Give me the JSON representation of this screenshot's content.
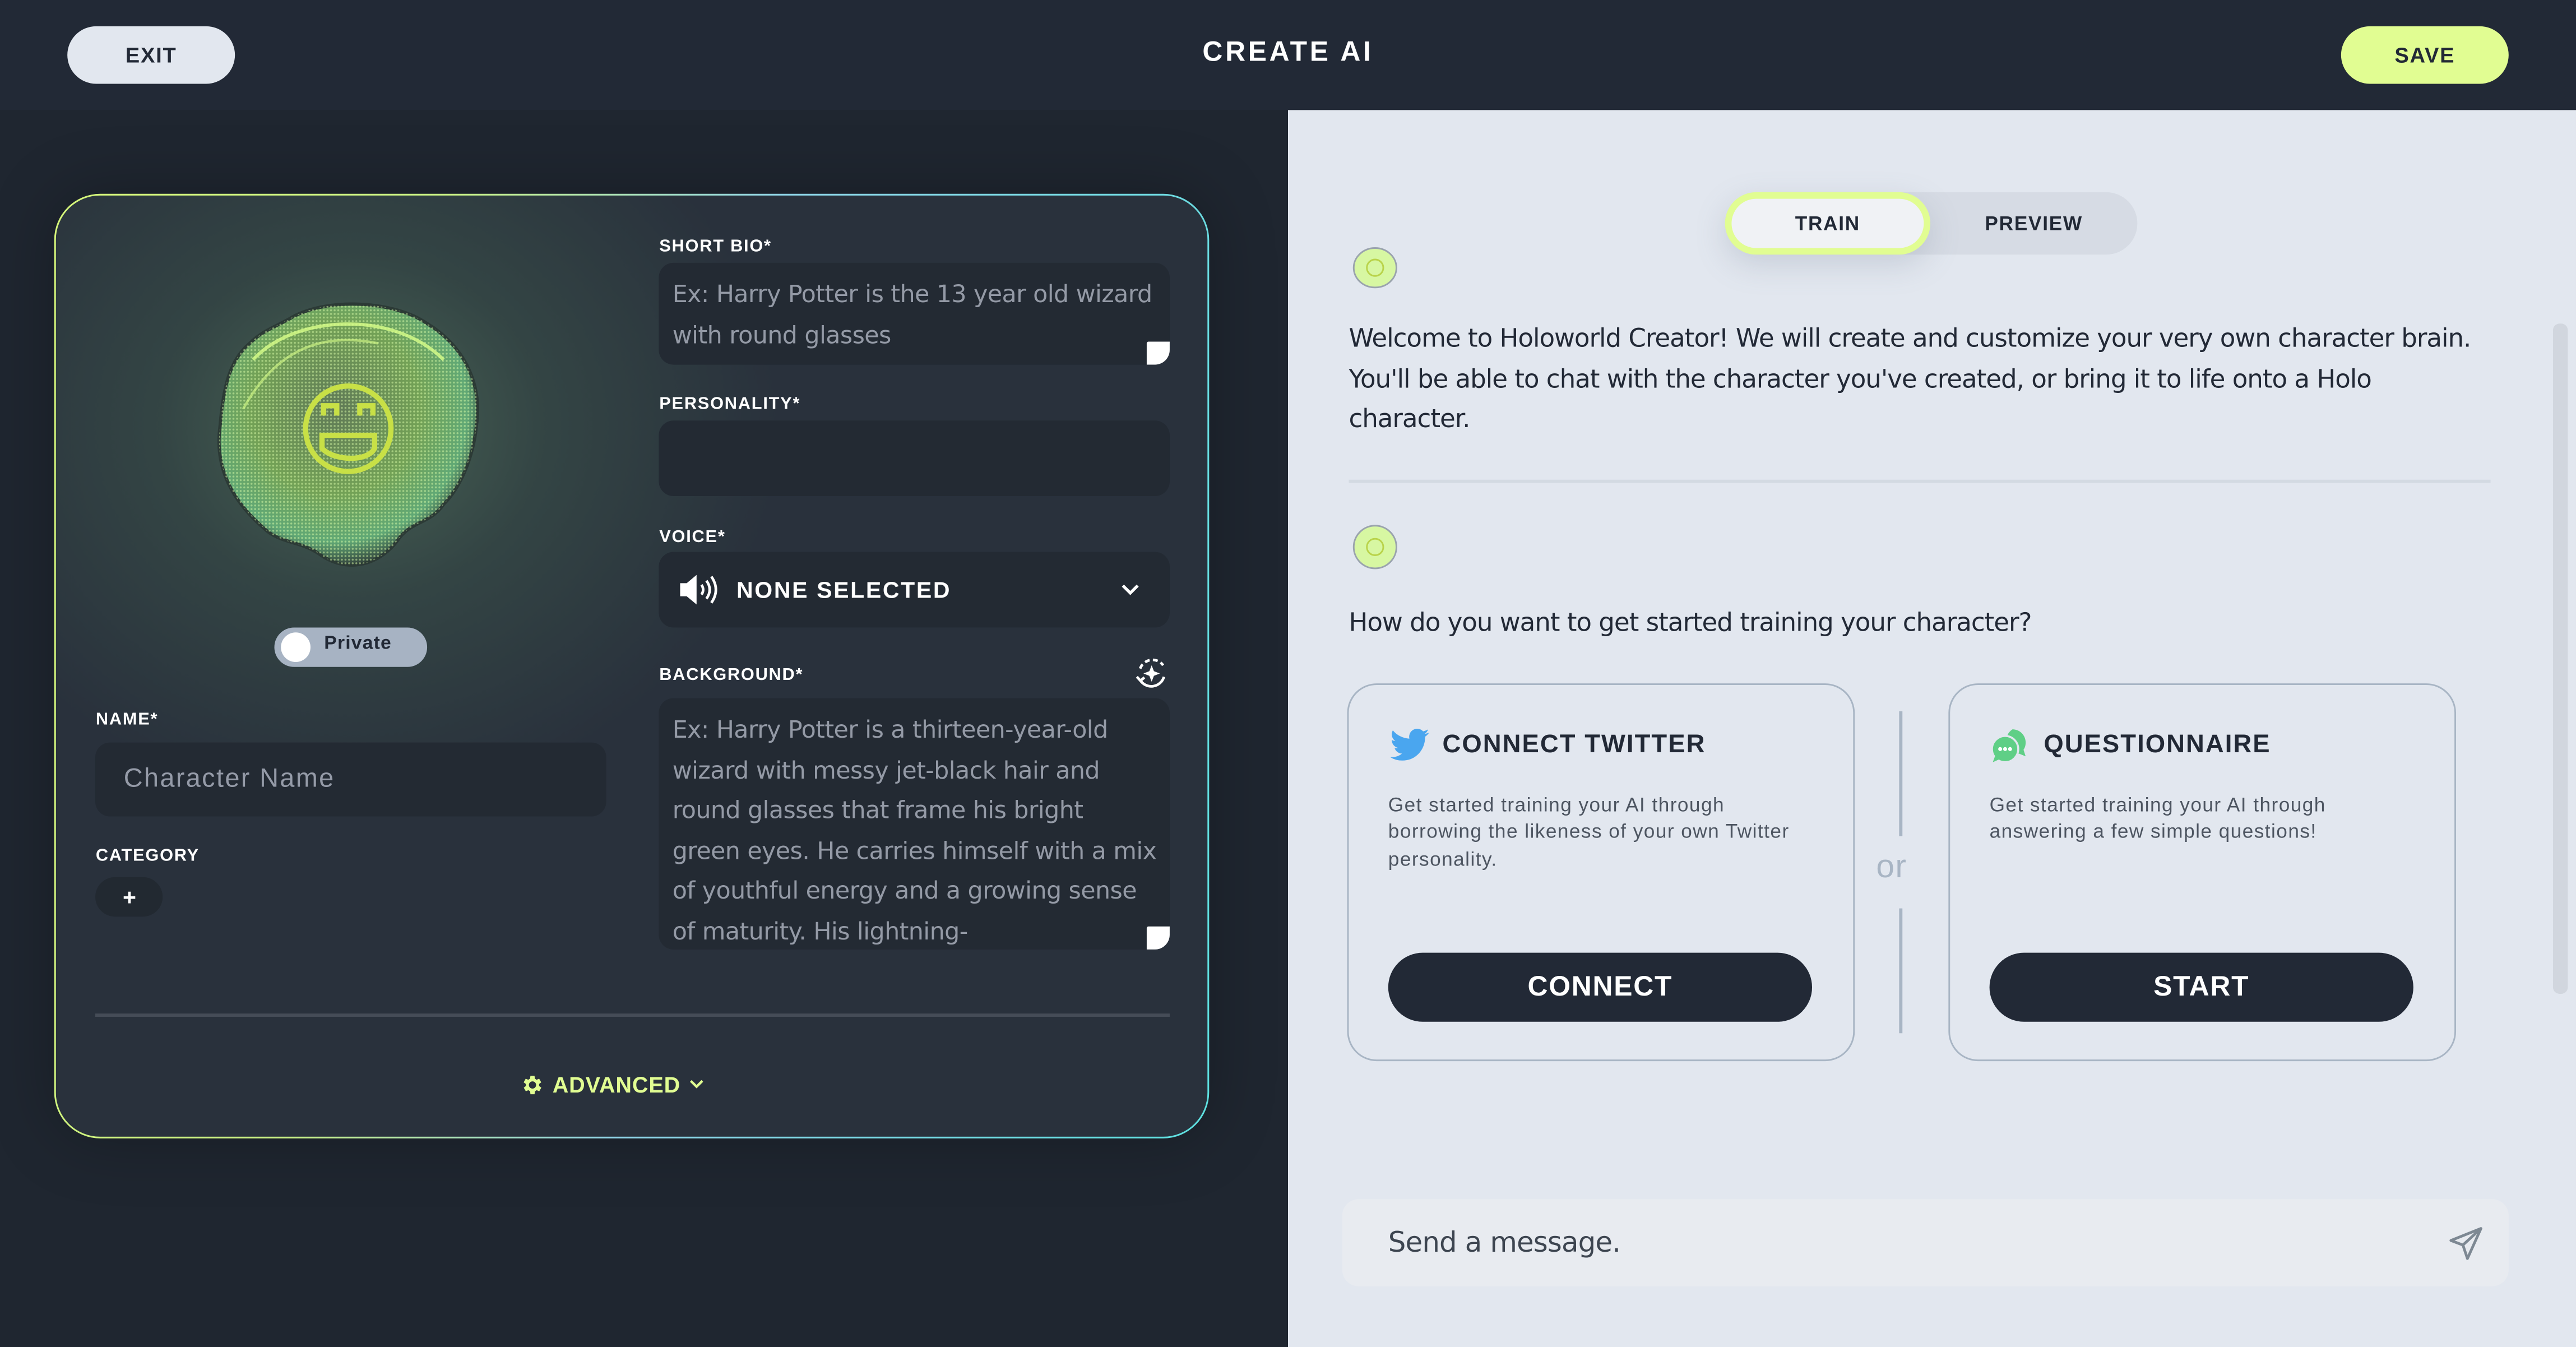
{
  "header": {
    "title": "CREATE AI",
    "exit_label": "EXIT",
    "save_label": "SAVE"
  },
  "colors": {
    "accent": "#e1fd92",
    "header_bg": "#222936",
    "left_bg": "#1f2630",
    "right_bg": "#e2e7ef",
    "twitter_blue": "#4aa6ef",
    "questionnaire_green": "#5fcf86"
  },
  "character_form": {
    "privacy_toggle": {
      "label": "Private",
      "on": false
    },
    "name": {
      "label": "NAME*",
      "value": "",
      "placeholder": "Character Name"
    },
    "category": {
      "label": "CATEGORY",
      "add_label": "+"
    },
    "short_bio": {
      "label": "SHORT BIO*",
      "value": "",
      "placeholder": "Ex: Harry Potter is the 13 year old wizard with round glasses"
    },
    "personality": {
      "label": "PERSONALITY*",
      "value": ""
    },
    "voice": {
      "label": "VOICE*",
      "selected": "NONE SELECTED",
      "icon": "speaker-icon"
    },
    "background": {
      "label": "BACKGROUND*",
      "value": "",
      "placeholder": "Ex: Harry Potter is a thirteen-year-old wizard with messy jet-black hair and round glasses that frame his bright green eyes. He carries himself with a mix of youthful energy and a growing sense of maturity. His lightning-",
      "generate_icon": "ai-regenerate-icon"
    },
    "advanced": {
      "label": "ADVANCED",
      "icon": "gear-icon"
    }
  },
  "training": {
    "tabs": [
      {
        "label": "TRAIN",
        "active": true
      },
      {
        "label": "PREVIEW",
        "active": false
      }
    ],
    "messages": [
      {
        "sender": "assistant",
        "text": "Welcome to Holoworld Creator! We will create and customize your very own character brain. You'll be able to chat with the character you've created, or bring it to life onto a Holo character."
      },
      {
        "sender": "assistant",
        "text": "How do you want to get started training your character?"
      }
    ],
    "options": [
      {
        "title": "CONNECT TWITTER",
        "icon": "twitter-bird-icon",
        "description": "Get started training your AI through borrowing the likeness of your own Twitter personality.",
        "button": "CONNECT"
      },
      {
        "title": "QUESTIONNAIRE",
        "icon": "chat-bubbles-icon",
        "description": "Get started training your AI through answering a few simple questions!",
        "button": "START"
      }
    ],
    "separator_text": "or",
    "composer": {
      "placeholder": "Send a message.",
      "value": ""
    }
  }
}
